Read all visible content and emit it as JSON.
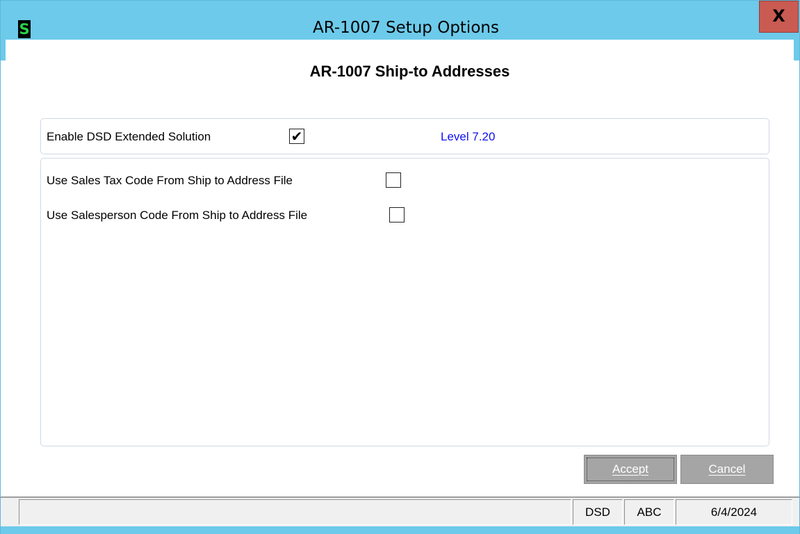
{
  "window": {
    "app_icon": "S",
    "title": "AR-1007  Setup Options",
    "close_label": "X"
  },
  "page": {
    "title": "AR-1007 Ship-to Addresses"
  },
  "options": {
    "enable_label": "Enable DSD Extended Solution",
    "enable_checked": true,
    "enable_check_glyph": "✔",
    "level_text": "Level  7.20",
    "sales_tax_label": "Use Sales Tax Code From Ship to Address File",
    "sales_tax_checked": false,
    "salesperson_label": "Use Salesperson Code From Ship to Address File",
    "salesperson_checked": false
  },
  "buttons": {
    "accept_label": "Accept",
    "cancel_label": "Cancel"
  },
  "statusbar": {
    "message": "",
    "module": "DSD",
    "company": "ABC",
    "date": "6/4/2024"
  },
  "colors": {
    "titlebar": "#6dcaea",
    "close_button": "#c95b52",
    "level_text": "#1010ee",
    "button_bg": "#a5a5a5"
  }
}
